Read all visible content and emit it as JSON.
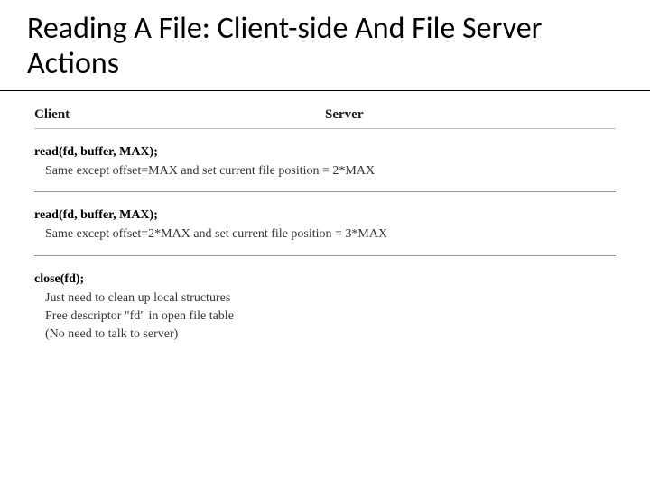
{
  "title": "Reading A File: Client-side And File Server Actions",
  "columns": {
    "client": "Client",
    "server": "Server"
  },
  "sections": [
    {
      "call": "read(fd, buffer, MAX);",
      "lines": [
        "Same except offset=MAX and set current file position = 2*MAX"
      ]
    },
    {
      "call": "read(fd, buffer, MAX);",
      "lines": [
        "Same except offset=2*MAX and set current file position = 3*MAX"
      ]
    },
    {
      "call": "close(fd);",
      "lines": [
        "Just need to clean up local structures",
        "Free descriptor \"fd\" in open file table",
        "(No need to talk to server)"
      ]
    }
  ]
}
